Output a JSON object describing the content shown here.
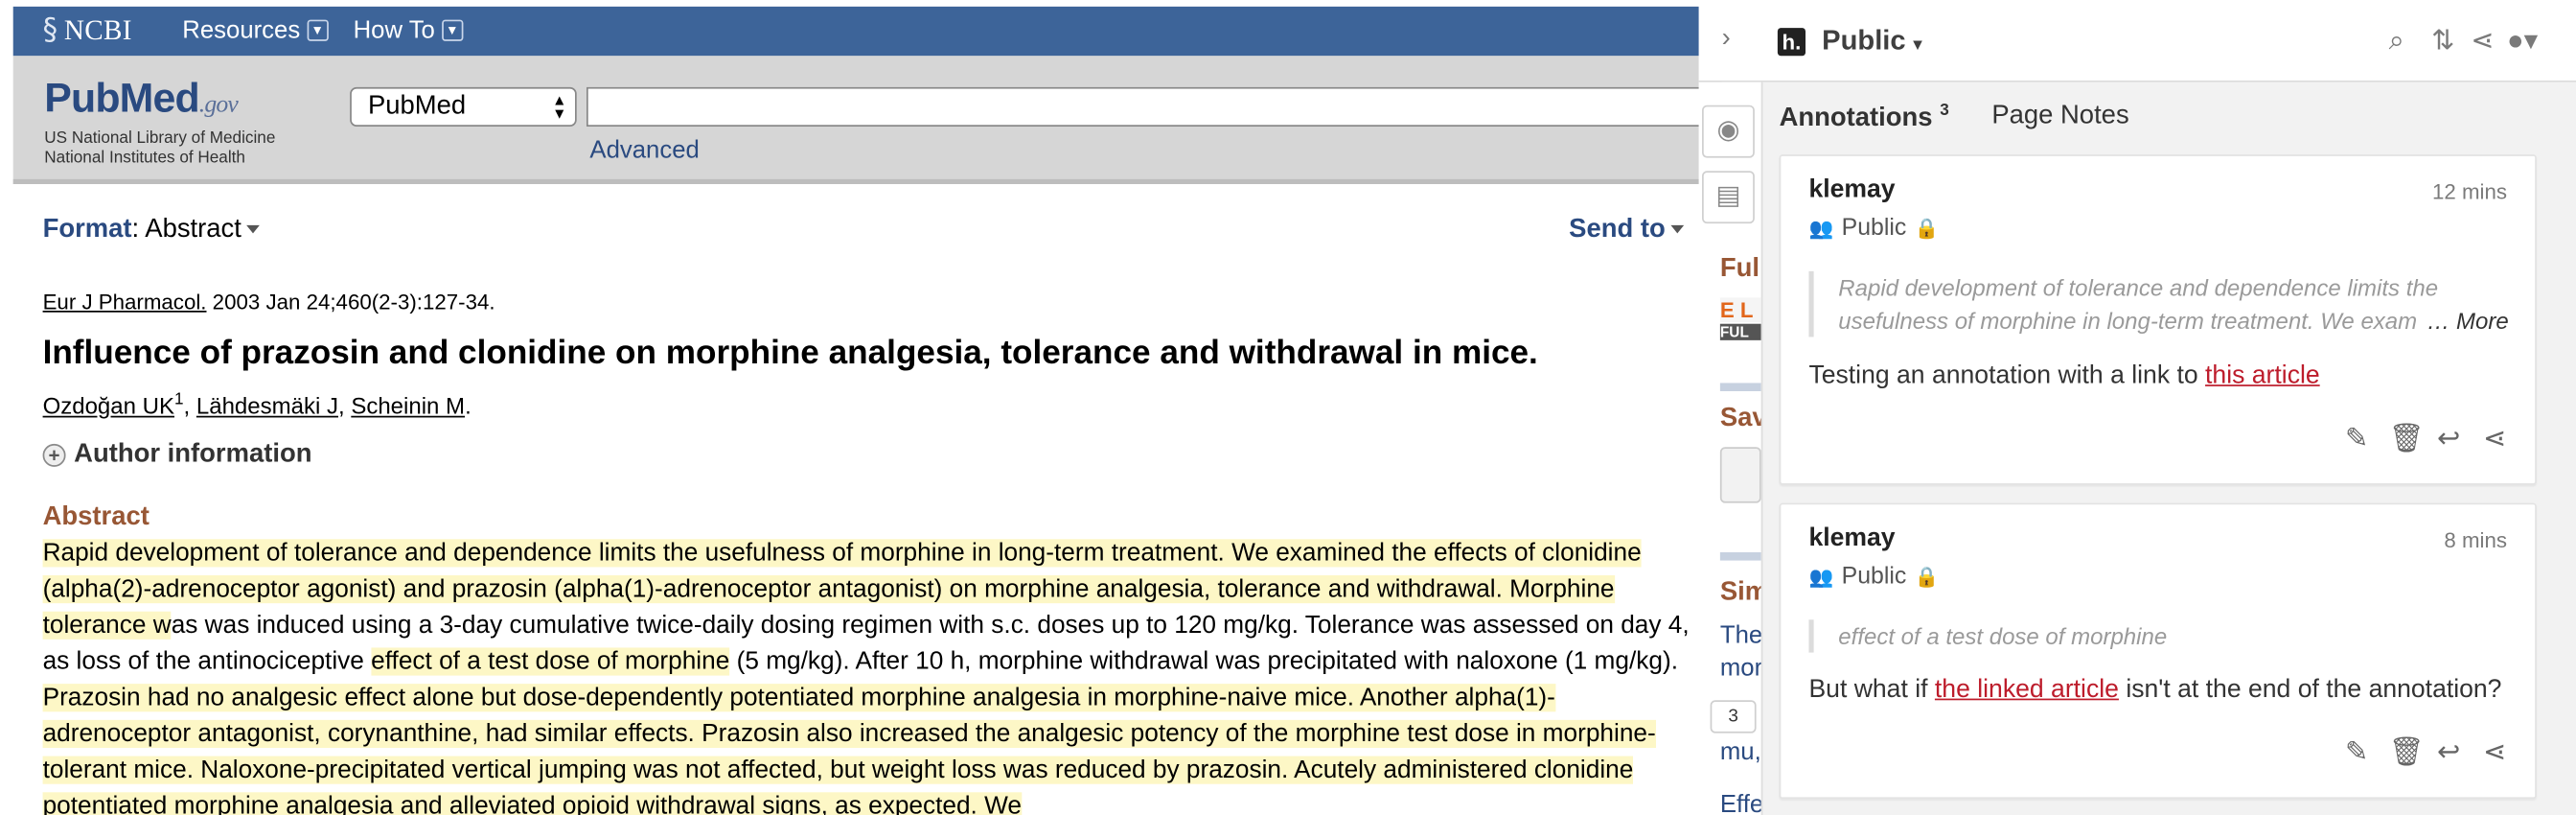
{
  "ncbi": {
    "logo_text": "NCBI",
    "menu": [
      {
        "label": "Resources"
      },
      {
        "label": "How To"
      }
    ]
  },
  "pubmed": {
    "logo_pub": "Pub",
    "logo_med": "Med",
    "logo_gov": ".gov",
    "nlm_line1": "US National Library of Medicine",
    "nlm_line2": "National Institutes of Health",
    "db_select_value": "PubMed",
    "search_value": "",
    "advanced_label": "Advanced"
  },
  "format": {
    "label": "Format",
    "value": "Abstract",
    "send_to": "Send to"
  },
  "article": {
    "journal": "Eur J Pharmacol.",
    "citation_rest": " 2003 Jan 24;460(2-3):127-34.",
    "title": "Influence of prazosin and clonidine on morphine analgesia, tolerance and withdrawal in mice.",
    "authors": [
      {
        "name": "Ozdoğan UK",
        "sup": "1",
        "sep": ", "
      },
      {
        "name": "Lähdesmäki J",
        "sup": "",
        "sep": ", "
      },
      {
        "name": "Scheinin M",
        "sup": "",
        "sep": "."
      }
    ],
    "author_info_label": "Author information",
    "abstract_heading": "Abstract",
    "abstract_segments": [
      {
        "text": "Rapid development of tolerance and dependence limits the usefulness of morphine in long-term treatment. We examined the effects of clonidine (alpha(2)-adrenoceptor agonist) and prazosin (alpha(1)-adrenoceptor antagonist) on morphine analgesia, tolerance and withdrawal. Morphine tolerance w",
        "hl": true
      },
      {
        "text": "as was induced using a 3-day cumulative twice-daily dosing regimen with s.c. doses up to 120 mg/kg. Tolerance was assessed on day 4, as loss of the antinociceptive ",
        "hl": false
      },
      {
        "text": "effect of a test dose of morphine",
        "hl": true
      },
      {
        "text": " (5 mg/kg). After 10 h, morphine withdrawal was precipitated with naloxone (1 mg/kg). ",
        "hl": false
      },
      {
        "text": "Prazosin had no analgesic effect alone but dose-dependently potentiated morphine analgesia in morphine-naive mice. Another alpha(1)-adrenoceptor antagonist, corynanthine, had similar effects. Prazosin also increased the analgesic potency of the morphine test dose in morphine-tolerant mice. Naloxone-precipitated vertical jumping was not affected, but weight loss was reduced by prazosin. Acutely administered clonidine potentiated morphine analgesia and alleviated opioid withdrawal signs, as expected. We",
        "hl": true
      }
    ]
  },
  "peek": {
    "full_text": "Full",
    "elsevier": "E L",
    "full_badge": "FUL",
    "save": "Save",
    "similar": "Sim",
    "line1": "The",
    "line2": "mor",
    "line3": "mu,",
    "line4": "Effe"
  },
  "hypothesis": {
    "group_name": "Public",
    "tab_annotations": "Annotations",
    "annotations_count": "3",
    "tab_page_notes": "Page Notes",
    "bucket_count": "3",
    "annotations": [
      {
        "user": "klemay",
        "time": "12 mins",
        "privacy": "Public",
        "quote": "Rapid development of tolerance and dependence limits the usefulness of morphine in long-term treatment. We exam",
        "more": "… More",
        "body_before": "Testing an annotation with a link to ",
        "link_text": "this article",
        "body_after": ""
      },
      {
        "user": "klemay",
        "time": "8 mins",
        "privacy": "Public",
        "quote": "effect of a test dose of morphine",
        "more": "",
        "body_before": "But what if ",
        "link_text": "the linked article",
        "body_after": " isn't at the end of the annotation?"
      }
    ]
  },
  "colors": {
    "ncbi_bar": "#3d6499",
    "pubmed_header": "#d6d6d6",
    "link_blue": "#2a4a80",
    "abstract_heading": "#985735",
    "highlight": "#fdf7c6",
    "annotation_link": "#bd1c2b",
    "sidebar_bg": "#f2f2f2"
  },
  "icons": {
    "search": "search-icon",
    "sort": "sort-icon",
    "share": "share-icon",
    "user": "user-icon",
    "eye": "eye-icon",
    "page_note": "page-note-icon",
    "edit": "edit-icon",
    "delete": "delete-icon",
    "reply": "reply-icon",
    "lock": "lock-icon"
  }
}
